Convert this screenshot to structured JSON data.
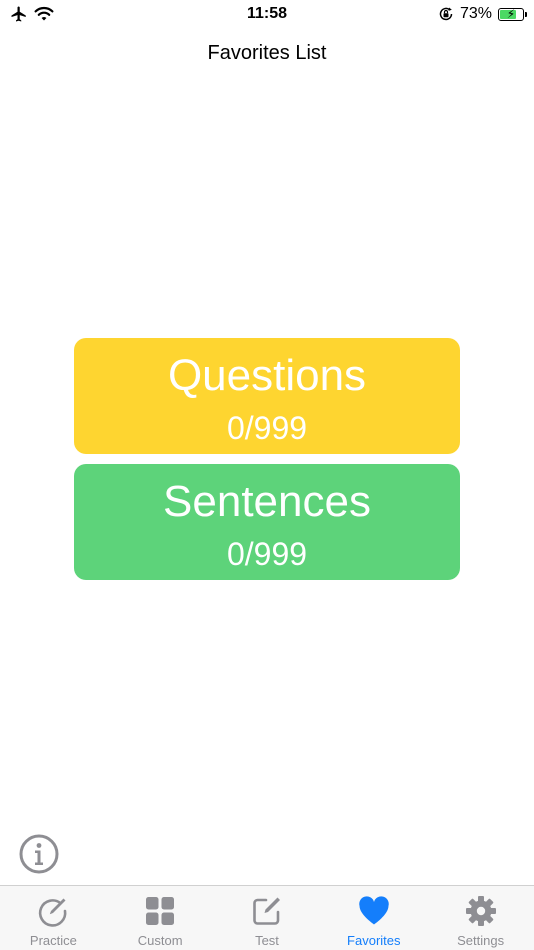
{
  "status_bar": {
    "time": "11:58",
    "battery_percent": "73%",
    "battery_level": 0.73,
    "icons": [
      "airplane-mode-icon",
      "wifi-icon",
      "orientation-lock-icon",
      "battery-charging-icon"
    ]
  },
  "nav": {
    "title": "Favorites List"
  },
  "cards": {
    "questions": {
      "title": "Questions",
      "count": "0/999",
      "color": "#fed530"
    },
    "sentences": {
      "title": "Sentences",
      "count": "0/999",
      "color": "#5dd37a"
    }
  },
  "info_button": {
    "icon": "info-icon"
  },
  "tab_bar": {
    "active_color": "#147efb",
    "inactive_color": "#8e8e93",
    "tabs": [
      {
        "label": "Practice",
        "icon": "pencil-circle-icon",
        "active": false
      },
      {
        "label": "Custom",
        "icon": "grid-icon",
        "active": false
      },
      {
        "label": "Test",
        "icon": "edit-square-icon",
        "active": false
      },
      {
        "label": "Favorites",
        "icon": "heart-icon",
        "active": true
      },
      {
        "label": "Settings",
        "icon": "gear-icon",
        "active": false
      }
    ]
  }
}
